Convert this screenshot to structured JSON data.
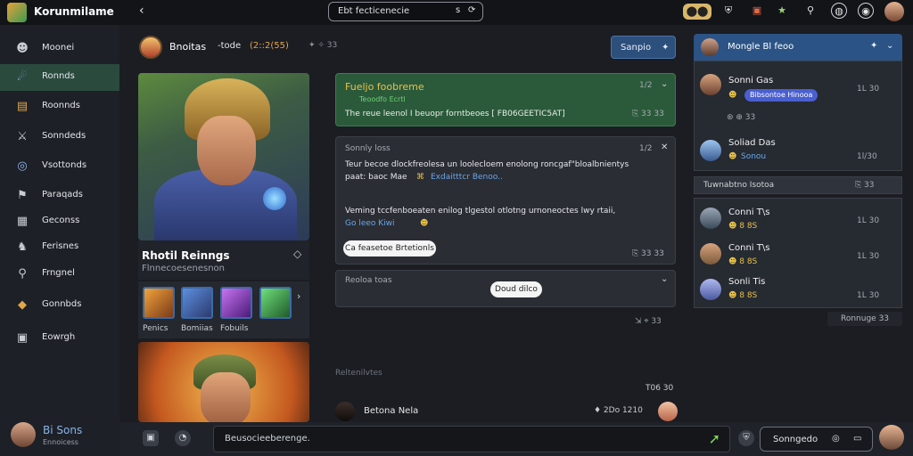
{
  "topbar": {
    "app_title": "Korunmilame",
    "back": "‹",
    "search_value": "Ebt fecticenecie",
    "search_icon_1": "s",
    "search_icon_2": "⟳",
    "coin_label": "⬤⬤",
    "icons": [
      "shield-icon",
      "chest-icon",
      "star-icon",
      "pin-icon",
      "globe-icon",
      "notification-icon"
    ]
  },
  "sidebar": {
    "items": [
      {
        "label": "Moonei",
        "icon": "☻"
      },
      {
        "label": "Ronnds",
        "icon": "☄"
      },
      {
        "label": "Roonnds",
        "icon": "▤"
      },
      {
        "label": "Sonndeds",
        "icon": "⚔"
      },
      {
        "label": "Vsottonds",
        "icon": "◎"
      },
      {
        "label": "Paraqads",
        "icon": "⚑"
      },
      {
        "label": "Geconss",
        "icon": "▦"
      },
      {
        "label": "Ferisnes",
        "icon": "♞"
      },
      {
        "label": "Frngnel",
        "icon": "⚲"
      },
      {
        "label": "Gonnbds",
        "icon": "◆"
      },
      {
        "label": "Eowrgh",
        "icon": "▣"
      }
    ],
    "user": {
      "name": "Bi Sons",
      "status": "Ennoicess"
    }
  },
  "header": {
    "name": "Bnoitas",
    "subtitle": "-tode",
    "tag": "(2::2(55)",
    "meta": "✦ ✧ 33",
    "button_label": "Sanpio",
    "button_icon": "✦"
  },
  "profile": {
    "name": "Rhotil Reinngs",
    "subtitle": "Flnnecoesenesnon",
    "skills": [
      {
        "label": "Penics",
        "color": "#e3862f"
      },
      {
        "label": "Bomiias",
        "color": "#3f6fbf"
      },
      {
        "label": "Fobuils",
        "color": "#9a3fd1"
      },
      {
        "label": "",
        "color": "#3aa14a"
      }
    ]
  },
  "chat": {
    "card1": {
      "title": "Fueljo foobreme",
      "sub": "Teoodfo Ecrtl",
      "body": "The reue leenol I beuopr forntbeoes [ FB06GEETIC5AT]",
      "time": "1/2",
      "foot": "⎘ 33 33"
    },
    "card2": {
      "head": "Sonnly loss",
      "line1": "Teur becoe dlockfreolesa un loolecloem enolong roncgaf\"bloalbnientys",
      "line2a": "paat: baoc Mae",
      "line2b": "⌘",
      "line2c": "Exdaitttcr Benoo..",
      "line3": "Veming tccfenboeaten enilog tlgestol otlotng urnoneoctes lwy rtaii,",
      "line4a": "Go leeo Kiwi",
      "line4b": "☻",
      "pill": "Ca feasetoe Brtetionls",
      "time": "1/2",
      "foot": "⎘ 33 33"
    },
    "card3": {
      "head": "Reoloa toas",
      "pill": "Doud dilco"
    },
    "footer_meta": "⇲ ⌖ 33",
    "section_label": "Reltenilvtes",
    "date_label": "T06 30",
    "last_msg": {
      "name": "Betona Nela",
      "time": "♦ 2Do 1210"
    },
    "composer_placeholder": "Beusocieeberenge.",
    "composer_button": "Sonngedo",
    "composer_icon_1": "◎",
    "composer_icon_2": "▭"
  },
  "right_panel": {
    "header": "Mongle Bl feoo",
    "header_icon_1": "✦",
    "header_icon_2": "⌄",
    "items": [
      {
        "name": "Sonni Gas",
        "time": "1L 30",
        "sub": "Bibsontoe Hinooa",
        "badge": true,
        "color": "#8a5a3a"
      },
      {
        "name": "Soliad Das",
        "time": "1l/30",
        "sub": "Sonou",
        "color": "#4a7abf"
      }
    ],
    "reactions": "⊛ ⊕ 33",
    "strip": "Tuwnabtno Isotoa",
    "strip_meta": "⎘ 33",
    "items2": [
      {
        "name": "Conni T\\s",
        "time": "1L 30",
        "sub": "☻ 8 8S",
        "color": "#3a4a5a"
      },
      {
        "name": "Conni T\\s",
        "time": "1L 30",
        "sub": "☻ 8 8S",
        "color": "#7a5a3a"
      },
      {
        "name": "Sonli Tis",
        "time": "1L 30",
        "sub": "☻ 8 8S",
        "color": "#4a5aa0"
      }
    ],
    "foot": "Ronnuge 33"
  }
}
